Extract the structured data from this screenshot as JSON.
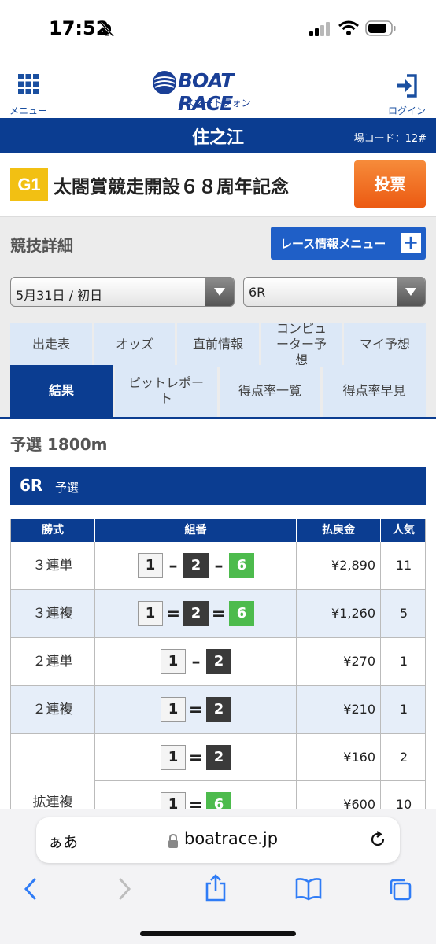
{
  "status_bar": {
    "time": "17:52"
  },
  "header": {
    "menu_label": "メニュー",
    "logo_text": "BOAT RACE",
    "logo_sub": "スマートフォン",
    "login_label": "ログイン"
  },
  "venue": {
    "name": "住之江",
    "code": "場コード：12#"
  },
  "race_title": {
    "grade": "G1",
    "name": "太閤賞競走開設６８周年記念",
    "vote_button": "投票"
  },
  "detail": {
    "heading": "競技詳細",
    "race_menu_button": "レース情報メニュー",
    "plus": "+"
  },
  "selects": {
    "date": "5月31日 / 初日",
    "race": "6R"
  },
  "tabs": {
    "row1": [
      "出走表",
      "オッズ",
      "直前情報",
      "コンピューター予想",
      "マイ予想"
    ],
    "row2": [
      "結果",
      "ピットレポート",
      "得点率一覧",
      "得点率早見"
    ],
    "active": "結果"
  },
  "race_info": {
    "subhead": "予選 1800m",
    "race_no": "6R",
    "race_kind": "予選"
  },
  "results_table": {
    "headers": [
      "勝式",
      "組番",
      "払戻金",
      "人気"
    ],
    "rows": [
      {
        "kind": "３連単",
        "combo": [
          "1",
          "–",
          "2",
          "–",
          "6"
        ],
        "payout": "¥2,890",
        "popularity": "11"
      },
      {
        "kind": "３連複",
        "combo": [
          "1",
          "=",
          "2",
          "=",
          "6"
        ],
        "payout": "¥1,260",
        "popularity": "5"
      },
      {
        "kind": "２連単",
        "combo": [
          "1",
          "–",
          "2"
        ],
        "payout": "¥270",
        "popularity": "1"
      },
      {
        "kind": "２連複",
        "combo": [
          "1",
          "=",
          "2"
        ],
        "payout": "¥210",
        "popularity": "1"
      },
      {
        "kind": "",
        "combo": [
          "1",
          "=",
          "2"
        ],
        "payout": "¥160",
        "popularity": "2"
      },
      {
        "kind": "",
        "combo": [
          "1",
          "=",
          "6"
        ],
        "payout": "¥600",
        "popularity": "10"
      }
    ],
    "group_label": "拡連複"
  },
  "safari": {
    "aa": "ぁあ",
    "url": "boatrace.jp"
  },
  "colors": {
    "navy": "#0b3d91",
    "tab_bg": "#dce8f7",
    "vote_orange": "#ec5a12",
    "grade_gold": "#f2c013",
    "boat2": "#3a3a3a",
    "boat6": "#4dbb4d"
  }
}
